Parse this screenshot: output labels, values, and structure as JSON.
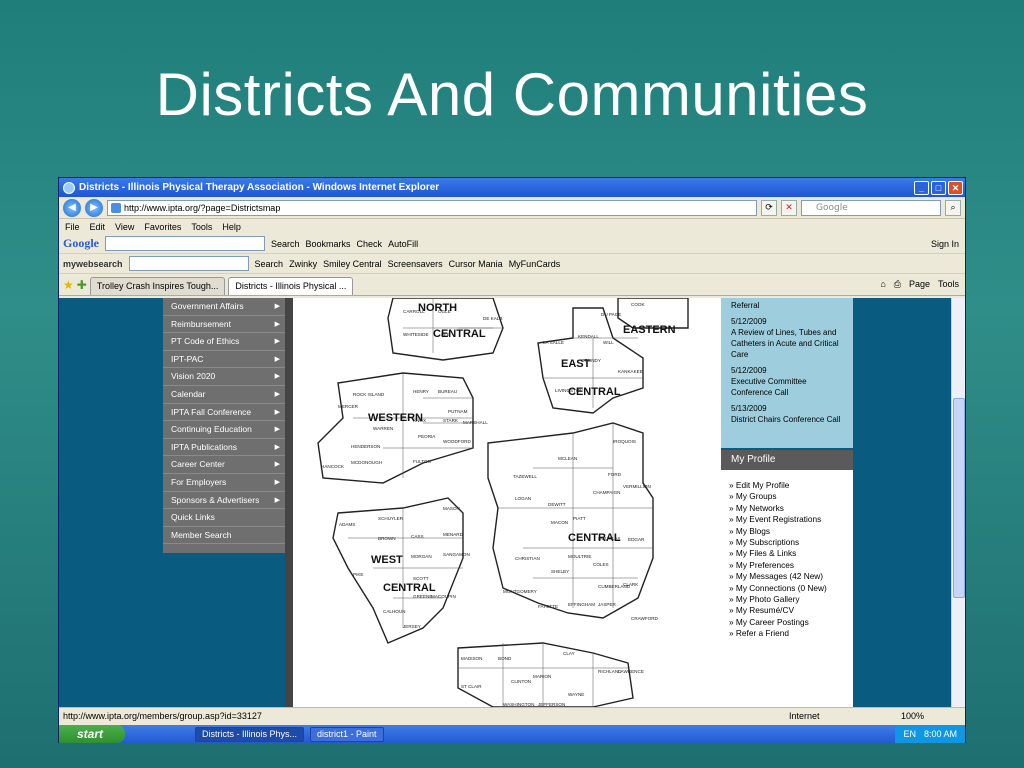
{
  "slide": {
    "title": "Districts And Communities"
  },
  "browser": {
    "window_title": "Districts - Illinois Physical Therapy Association - Windows Internet Explorer",
    "address": "http://www.ipta.org/?page=Districtsmap",
    "search_placeholder": "Google",
    "menu": [
      "File",
      "Edit",
      "View",
      "Favorites",
      "Tools",
      "Help"
    ],
    "google_toolbar": {
      "logo": "Google",
      "search": "Search",
      "bookmarks": "Bookmarks",
      "check": "Check",
      "autofill": "AutoFill",
      "sign_in": "Sign In"
    },
    "websearch_toolbar": {
      "logo": "mywebsearch",
      "search": "Search",
      "zwinky": "Zwinky",
      "smiley": "Smiley Central",
      "screensavers": "Screensavers",
      "cursor": "Cursor Mania",
      "funcards": "MyFunCards"
    },
    "tabs": [
      {
        "label": "Trolley Crash Inspires Tough..."
      },
      {
        "label": "Districts - Illinois Physical ..."
      }
    ],
    "tab_tools": {
      "page": "Page",
      "tools": "Tools"
    },
    "status_url": "http://www.ipta.org/members/group.asp?id=33127",
    "zone": "Internet",
    "zoom": "100%"
  },
  "sidebar": {
    "items": [
      {
        "label": "Government Affairs"
      },
      {
        "label": "Reimbursement"
      },
      {
        "label": "PT Code of Ethics"
      },
      {
        "label": "IPT-PAC"
      },
      {
        "label": "Vision 2020"
      },
      {
        "label": "Calendar"
      },
      {
        "label": "IPTA Fall Conference"
      },
      {
        "label": "Continuing Education"
      },
      {
        "label": "IPTA Publications"
      },
      {
        "label": "Career Center"
      },
      {
        "label": "For Employers"
      },
      {
        "label": "Sponsors & Advertisers"
      },
      {
        "label": "Quick Links"
      },
      {
        "label": "Member Search"
      }
    ]
  },
  "map": {
    "districts": [
      "NORTH",
      "CENTRAL",
      "EASTERN",
      "EAST",
      "CENTRAL",
      "WESTERN",
      "CENTRAL",
      "WEST",
      "CENTRAL"
    ],
    "counties": [
      "CARROLL",
      "OGLE",
      "DE KALB",
      "WHITESIDE",
      "LEE",
      "COOK",
      "DU PAGE",
      "KENDALL",
      "WILL",
      "LA SALLE",
      "GRUNDY",
      "KANKAKEE",
      "LIVINGSTON",
      "HENRY",
      "BUREAU",
      "ROCK ISLAND",
      "MERCER",
      "PUTNAM",
      "KNOX",
      "STARK",
      "MARSHALL",
      "WARREN",
      "PEORIA",
      "WOODFORD",
      "HENDERSON",
      "HANCOCK",
      "MCDONOUGH",
      "FULTON",
      "IROQUOIS",
      "TAZEWELL",
      "MCLEAN",
      "FORD",
      "VERMILLION",
      "CHAMPAIGN",
      "LOGAN",
      "DEWITT",
      "PIATT",
      "MACON",
      "DOUGLAS",
      "EDGAR",
      "ADAMS",
      "SCHUYLER",
      "MASON",
      "BROWN",
      "CASS",
      "MENARD",
      "MORGAN",
      "SANGAMON",
      "PIKE",
      "SCOTT",
      "CHRISTIAN",
      "MOULTRIE",
      "COLES",
      "SHELBY",
      "CUMBERLAND",
      "CLARK",
      "MONTGOMERY",
      "GREENE",
      "MACOUPIN",
      "FAYETTE",
      "EFFINGHAM",
      "JASPER",
      "CRAWFORD",
      "CALHOUN",
      "JERSEY",
      "MADISON",
      "BOND",
      "CLAY",
      "RICHLAND",
      "LAWRENCE",
      "CLINTON",
      "MARION",
      "ST CLAIR",
      "WAYNE",
      "WASHINGTON",
      "JEFFERSON"
    ]
  },
  "news": {
    "top_cut": "Referral",
    "items": [
      {
        "date": "5/12/2009",
        "text": "A Review of Lines, Tubes and Catheters in Acute and Critical Care"
      },
      {
        "date": "5/12/2009",
        "text": "Executive Committee Conference Call"
      },
      {
        "date": "5/13/2009",
        "text": "District Chairs Conference Call"
      }
    ]
  },
  "profile": {
    "heading": "My Profile",
    "links": [
      "» Edit My Profile",
      "» My Groups",
      "» My Networks",
      "» My Event Registrations",
      "» My Blogs",
      "» My Subscriptions",
      "» My Files & Links",
      "» My Preferences",
      "» My Messages (42 New)",
      "» My Connections (0 New)",
      "» My Photo Gallery",
      "» My Resumé/CV",
      "» My Career Postings",
      "» Refer a Friend"
    ]
  },
  "taskbar": {
    "start": "start",
    "tasks": [
      "Districts - Illinois Phys...",
      "district1 - Paint"
    ],
    "lang": "EN",
    "clock": "8:00 AM"
  }
}
